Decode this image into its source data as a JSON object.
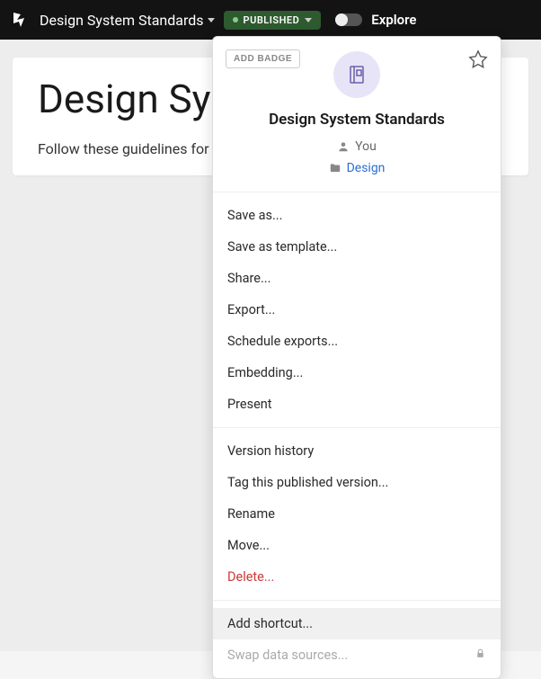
{
  "topbar": {
    "title": "Design System Standards",
    "status_badge": "PUBLISHED",
    "explore_label": "Explore"
  },
  "page": {
    "title": "Design System Standards",
    "subtitle": "Follow these guidelines for consistency in our marketing pages"
  },
  "dropdown": {
    "add_badge_label": "ADD BADGE",
    "title": "Design System Standards",
    "owner_label": "You",
    "folder_label": "Design",
    "menu_section1": [
      "Save as...",
      "Save as template...",
      "Share...",
      "Export...",
      "Schedule exports...",
      "Embedding...",
      "Present"
    ],
    "menu_section2": [
      "Version history",
      "Tag this published version...",
      "Rename",
      "Move...",
      "Delete..."
    ],
    "menu_section3_hover": "Add shortcut...",
    "menu_section3_disabled": "Swap data sources..."
  }
}
